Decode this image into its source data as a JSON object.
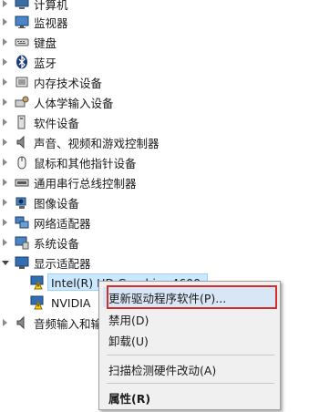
{
  "device_categories": [
    {
      "label": "计算机",
      "icon": "computer-icon",
      "expanded": false
    },
    {
      "label": "监视器",
      "icon": "monitor-icon",
      "expanded": false
    },
    {
      "label": "键盘",
      "icon": "keyboard-icon",
      "expanded": false
    },
    {
      "label": "蓝牙",
      "icon": "bluetooth-icon",
      "expanded": false
    },
    {
      "label": "内存技术设备",
      "icon": "memory-device-icon",
      "expanded": false
    },
    {
      "label": "人体学输入设备",
      "icon": "hid-icon",
      "expanded": false
    },
    {
      "label": "软件设备",
      "icon": "software-device-icon",
      "expanded": false
    },
    {
      "label": "声音、视频和游戏控制器",
      "icon": "sound-icon",
      "expanded": false
    },
    {
      "label": "鼠标和其他指针设备",
      "icon": "mouse-icon",
      "expanded": false
    },
    {
      "label": "通用串行总线控制器",
      "icon": "usb-icon",
      "expanded": false
    },
    {
      "label": "图像设备",
      "icon": "camera-icon",
      "expanded": false
    },
    {
      "label": "网络适配器",
      "icon": "network-adapter-icon",
      "expanded": false
    },
    {
      "label": "系统设备",
      "icon": "system-device-icon",
      "expanded": false
    },
    {
      "label": "显示适配器",
      "icon": "display-adapter-icon",
      "expanded": true
    }
  ],
  "display_adapters": [
    {
      "label": "Intel(R) HD Graphics 4600",
      "icon": "warning-display-icon",
      "selected": true
    },
    {
      "label": "NVIDIA",
      "icon": "warning-display-icon",
      "selected": false
    }
  ],
  "after_category": {
    "label": "音频输入和输出",
    "icon": "audio-io-icon"
  },
  "context_menu": {
    "update_driver": "更新驱动程序软件(P)...",
    "disable": "禁用(D)",
    "uninstall": "卸载(U)",
    "scan": "扫描检测硬件改动(A)",
    "properties": "属性(R)"
  },
  "colors": {
    "selection": "#cce8ff",
    "highlight_box": "#d32f2f",
    "menu_bg": "#f0f0f0"
  }
}
